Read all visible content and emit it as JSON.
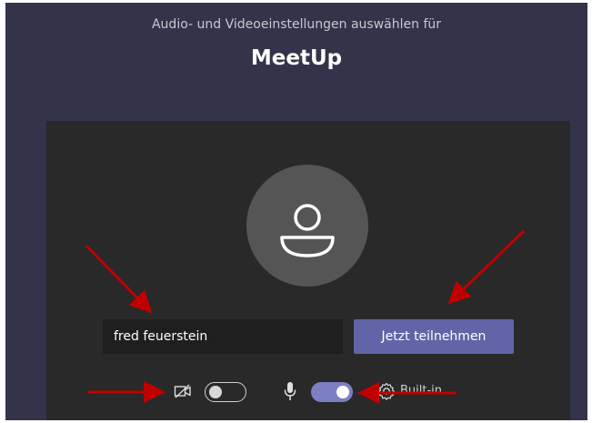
{
  "header": {
    "subtitle": "Audio- und Videoeinstellungen auswählen für",
    "title": "MeetUp"
  },
  "avatar": {
    "icon": "person-icon"
  },
  "name_input": {
    "value": "fred feuerstein"
  },
  "join_button": {
    "label": "Jetzt teilnehmen"
  },
  "controls": {
    "camera_icon": "camera-off-icon",
    "camera_toggle_on": false,
    "microphone_icon": "microphone-icon",
    "microphone_toggle_on": true,
    "settings_icon": "gear-icon",
    "device_label": "Built-in"
  },
  "colors": {
    "background": "#33344a",
    "panel": "#292929",
    "accent": "#6264a7",
    "toggle_on": "#7d7fc4",
    "annotation_arrow": "#c00000"
  }
}
